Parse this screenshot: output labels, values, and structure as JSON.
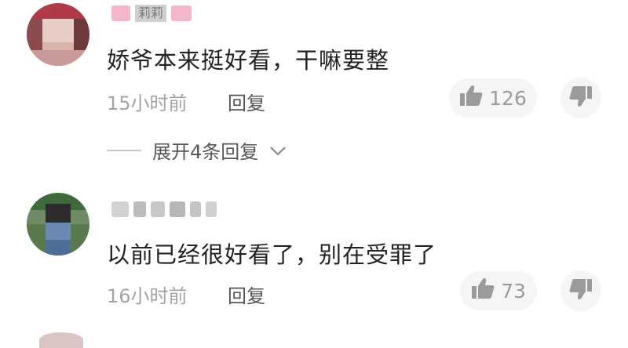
{
  "colors": {
    "text_main": "#222222",
    "text_muted": "#a3a3a3",
    "button_bg": "#f5f5f5"
  },
  "comments": [
    {
      "username": "莉莉",
      "text": "娇爷本来挺好看，干嘛要整",
      "time": "15小时前",
      "reply_label": "回复",
      "like_count": "126",
      "expand_label": "展开4条回复"
    },
    {
      "username": "",
      "text": "以前已经很好看了，别在受罪了",
      "time": "16小时前",
      "reply_label": "回复",
      "like_count": "73"
    }
  ],
  "icons": {
    "like": "thumbs-up-icon",
    "dislike": "thumbs-down-icon",
    "expand": "chevron-down-icon"
  }
}
